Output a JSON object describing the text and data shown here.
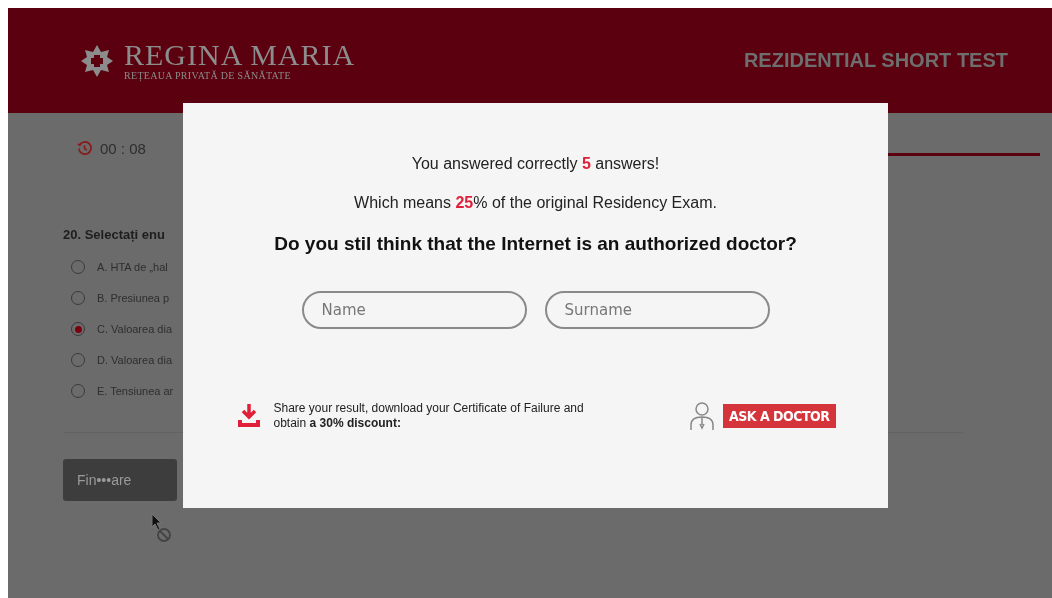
{
  "header": {
    "logo_title": "REGINA MARIA",
    "logo_subtitle": "REȚEAUA PRIVATĂ DE SĂNĂTATE",
    "test_title": "REZIDENTIAL SHORT TEST"
  },
  "timer": "00 : 08",
  "question": {
    "title": "20. Selectați enu",
    "options": [
      {
        "label": "A. HTA de „hal",
        "selected": false
      },
      {
        "label": "B. Presiunea p",
        "selected": false
      },
      {
        "label": "C. Valoarea dia",
        "selected": true
      },
      {
        "label": "D. Valoarea dia",
        "selected": false
      },
      {
        "label": "E. Tensiunea ar",
        "selected": false
      }
    ]
  },
  "finish_button": "Fin•••are",
  "modal": {
    "result_line": "You answered correctly **5** answers!",
    "percent_line": "Which means **25**% of the original Residency Exam.",
    "heading": "Do you stil think that the Internet is an authorized doctor?",
    "fields": [
      {
        "placeholder": "Name"
      },
      {
        "placeholder": "Surname"
      }
    ],
    "share_text": "Share your result, download your Certificate of Failure and obtain **a 30% discount:**",
    "ask_button": "ASK A DOCTOR"
  }
}
